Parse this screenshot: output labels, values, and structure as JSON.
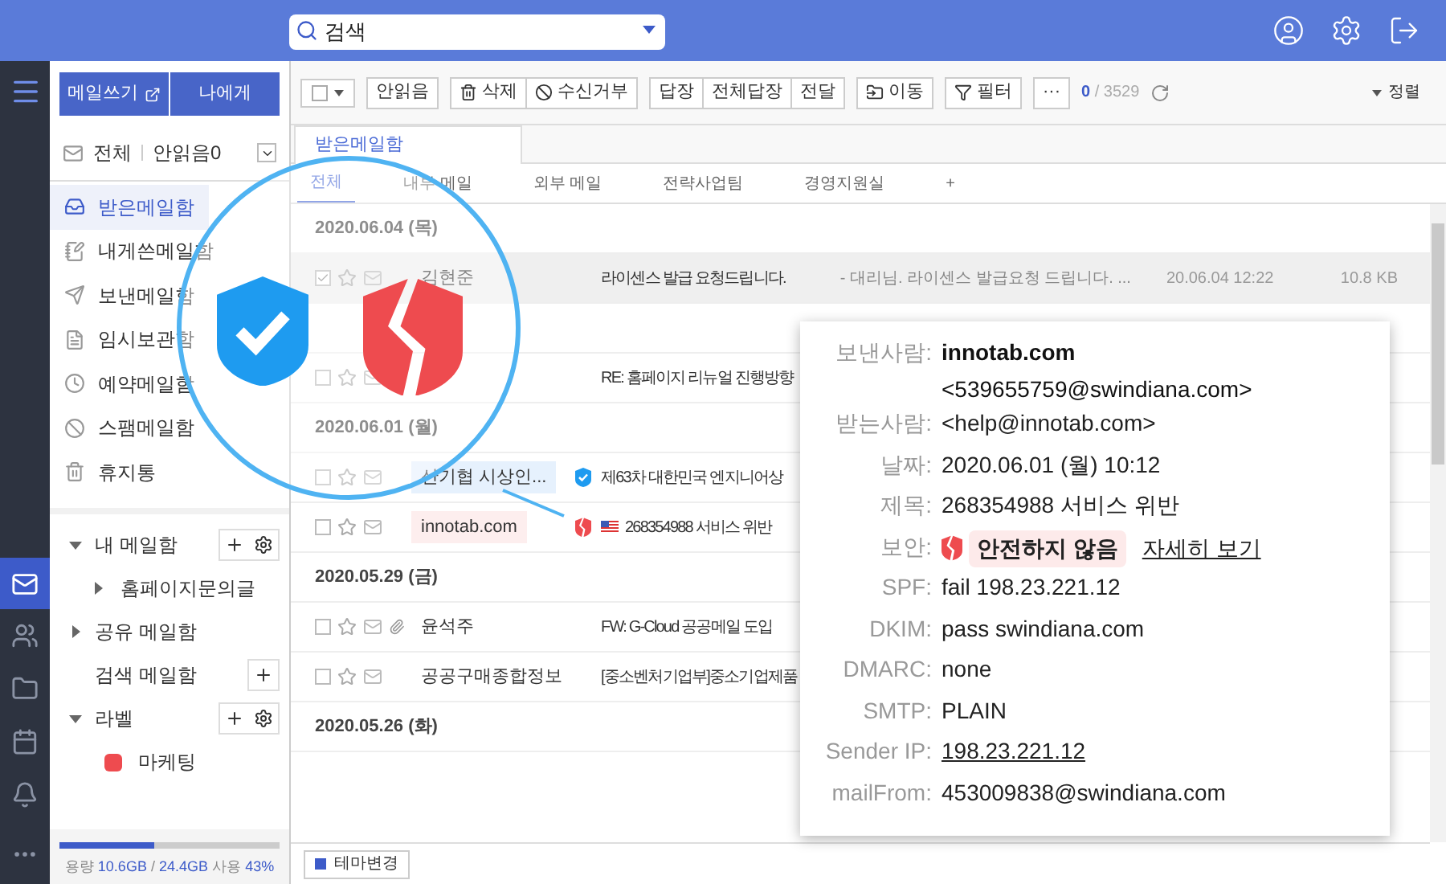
{
  "search": {
    "placeholder": "검색"
  },
  "sidebar": {
    "compose": "메일쓰기",
    "to_me": "나에게",
    "all": "전체",
    "unread": "안읽음0",
    "folders": [
      {
        "label": "받은메일함",
        "selected": true
      },
      {
        "label": "내게쓴메일함",
        "selected": false
      },
      {
        "label": "보낸메일함",
        "selected": false
      },
      {
        "label": "임시보관함",
        "selected": false
      },
      {
        "label": "예약메일함",
        "selected": false
      },
      {
        "label": "스팸메일함",
        "selected": false
      },
      {
        "label": "휴지통",
        "selected": false
      }
    ],
    "groups": [
      {
        "label": "내 메일함",
        "kind": "full",
        "expanded": true,
        "children": [
          {
            "label": "홈페이지문의글"
          }
        ]
      },
      {
        "label": "공유 메일함",
        "kind": "plain",
        "expanded": false
      },
      {
        "label": "검색 메일함",
        "kind": "add"
      },
      {
        "label": "라벨",
        "kind": "full",
        "expanded": true,
        "children": [
          {
            "label": "마케팅",
            "color": "#ee4b4f"
          }
        ]
      }
    ],
    "usage": {
      "label": "용량",
      "used": "10.6GB",
      "separator": "/",
      "total": "24.4GB",
      "use": "사용",
      "percent": "43%",
      "level": 0.43
    }
  },
  "toolbar": {
    "buttons": [
      {
        "label": "안읽음"
      },
      {
        "label": "삭제"
      },
      {
        "label": "수신거부"
      },
      {
        "label": "답장"
      },
      {
        "label": "전체답장"
      },
      {
        "label": "전달"
      },
      {
        "label": "이동"
      },
      {
        "label": "필터"
      },
      {
        "label": "···"
      }
    ],
    "selected_count": "0",
    "total": "/ 3529",
    "sort": "정렬"
  },
  "tabs": [
    {
      "label": "받은메일함",
      "selected": true
    }
  ],
  "subtabs": [
    {
      "label": "전체",
      "selected": true
    },
    {
      "label": "내부 메일",
      "selected": false
    },
    {
      "label": "외부 메일",
      "selected": false
    },
    {
      "label": "전략사업팀",
      "selected": false
    },
    {
      "label": "경영지원실",
      "selected": false
    },
    {
      "label": "+",
      "selected": false
    }
  ],
  "list": [
    {
      "kind": "date",
      "label": "2020.06.04 (목)"
    },
    {
      "kind": "mail",
      "selected": true,
      "checked": true,
      "sender": "김현준",
      "subject": "라이센스 발급 요청드립니다.",
      "preview": "- 대리님. 라이센스 발급요청 드립니다. ...",
      "date": "20.06.04 12:22",
      "size": "10.8 KB",
      "attachment": false,
      "flag": false
    },
    {
      "kind": "date"
    },
    {
      "kind": "mail",
      "selected": false,
      "checked": false,
      "subject": "RE: 홈페이지 리뉴얼 진행방향",
      "attachment": false,
      "flag": false
    },
    {
      "kind": "date",
      "label": "2020.06.01 (월)"
    },
    {
      "kind": "mail",
      "selected": false,
      "checked": false,
      "sender": "산기협 시상인...",
      "color": "#e6f1fd",
      "secure": true,
      "subject": "제63차 대한민국 엔지니어상",
      "attachment": false,
      "flag": false
    },
    {
      "kind": "mail",
      "selected": false,
      "checked": false,
      "sender": "innotab.com",
      "color": "#fdeeee",
      "secure": false,
      "subject": "268354988 서비스 위반",
      "attachment": false,
      "flag": true
    },
    {
      "kind": "date",
      "label": "2020.05.29 (금)"
    },
    {
      "kind": "mail",
      "selected": false,
      "checked": false,
      "sender": "윤석주",
      "subject": "FW: G-Cloud 공공메일 도입",
      "attachment": true,
      "flag": false
    },
    {
      "kind": "mail",
      "selected": false,
      "checked": false,
      "sender": "공공구매종합정보",
      "subject": "[중소벤처기업부]중소기업제품",
      "attachment": false,
      "flag": false
    },
    {
      "kind": "date",
      "label": "2020.05.26 (화)"
    }
  ],
  "footer": {
    "theme": "테마변경"
  },
  "popup": {
    "rows": [
      {
        "label": "보낸사람:",
        "kind": "sender",
        "value": "innotab.com",
        "value2": "<539655759@swindiana.com>"
      },
      {
        "label": "받는사람:",
        "kind": "text",
        "value": "<help@innotab.com>"
      },
      {
        "label": "날짜:",
        "kind": "text",
        "value": "2020.06.01 (월) 10:12"
      },
      {
        "label": "제목:",
        "kind": "text",
        "value": "268354988 서비스 위반"
      },
      {
        "label": "보안:",
        "kind": "security",
        "value": "안전하지 않음",
        "link": "자세히 보기"
      },
      {
        "label": "SPF:",
        "kind": "text",
        "value": "fail 198.23.221.12"
      },
      {
        "label": "DKIM:",
        "kind": "text",
        "value": "pass swindiana.com"
      },
      {
        "label": "DMARC:",
        "kind": "text",
        "value": "none"
      },
      {
        "label": "SMTP:",
        "kind": "text",
        "value": "PLAIN"
      },
      {
        "label": "Sender IP:",
        "kind": "link",
        "value": "198.23.221.12"
      },
      {
        "label": "mailFrom:",
        "kind": "text",
        "value": "453009838@swindiana.com"
      }
    ]
  }
}
